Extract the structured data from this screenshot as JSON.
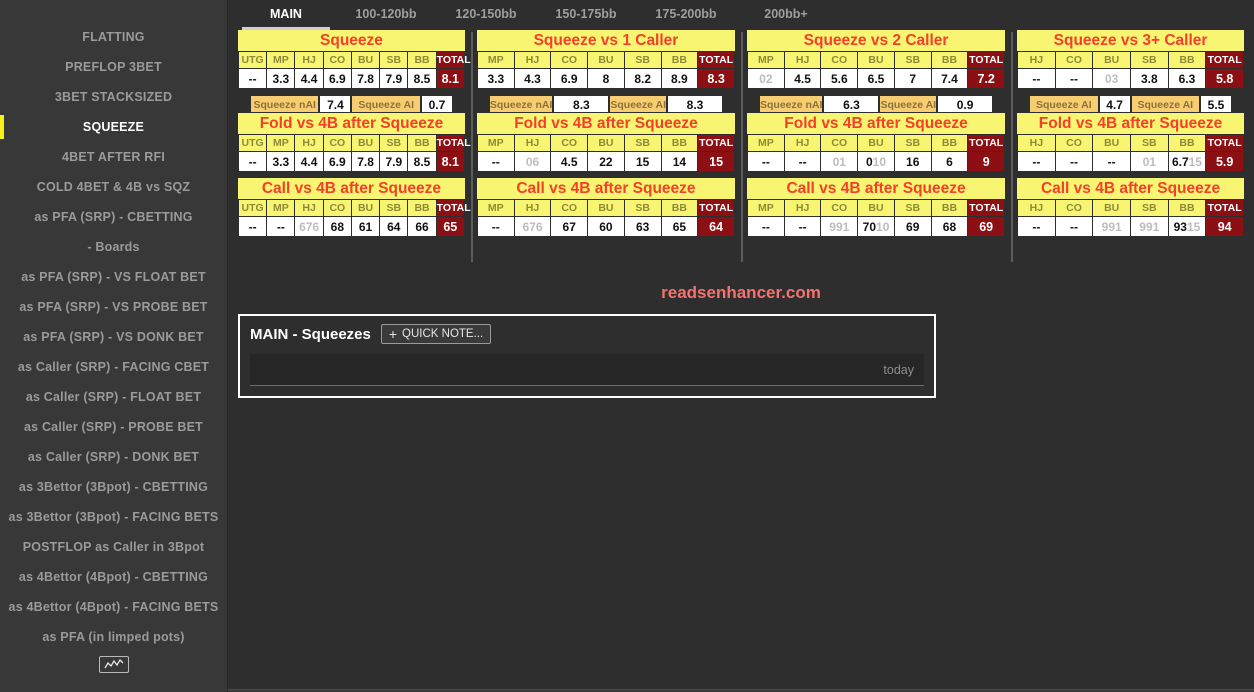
{
  "sidebar": {
    "items": [
      {
        "label": "FLATTING",
        "active": false
      },
      {
        "label": "PREFLOP 3BET",
        "active": false
      },
      {
        "label": "3BET STACKSIZED",
        "active": false
      },
      {
        "label": "SQUEEZE",
        "active": true
      },
      {
        "label": "4BET AFTER RFI",
        "active": false
      },
      {
        "label": "COLD 4BET & 4B vs SQZ",
        "active": false
      },
      {
        "label": "as PFA (SRP) - CBETTING",
        "active": false
      },
      {
        "label": "- Boards",
        "active": false
      },
      {
        "label": "as PFA (SRP) - VS FLOAT BET",
        "active": false
      },
      {
        "label": "as PFA (SRP) - VS PROBE BET",
        "active": false
      },
      {
        "label": "as PFA (SRP) - VS DONK BET",
        "active": false
      },
      {
        "label": "as Caller (SRP) - FACING CBET",
        "active": false
      },
      {
        "label": "as Caller (SRP) - FLOAT BET",
        "active": false
      },
      {
        "label": "as Caller (SRP) - PROBE BET",
        "active": false
      },
      {
        "label": "as Caller (SRP) - DONK BET",
        "active": false
      },
      {
        "label": "as 3Bettor (3Bpot) - CBETTING",
        "active": false
      },
      {
        "label": "as 3Bettor (3Bpot) - FACING BETS",
        "active": false
      },
      {
        "label": "POSTFLOP as Caller in 3Bpot",
        "active": false
      },
      {
        "label": "as 4Bettor (4Bpot) - CBETTING",
        "active": false
      },
      {
        "label": "as 4Bettor (4Bpot) - FACING BETS",
        "active": false
      },
      {
        "label": "as PFA (in limped pots)",
        "active": false
      }
    ],
    "chart_button_icon": "line-chart-icon",
    "active_accent_color": "#f5f015"
  },
  "tabs": [
    {
      "label": "MAIN",
      "active": true
    },
    {
      "label": "100-120bb",
      "active": false
    },
    {
      "label": "120-150bb",
      "active": false
    },
    {
      "label": "150-175bb",
      "active": false
    },
    {
      "label": "175-200bb",
      "active": false
    },
    {
      "label": "200bb+",
      "active": false
    }
  ],
  "columns": [
    {
      "blocks": [
        {
          "title": "Squeeze",
          "headers": [
            "UTG",
            "MP",
            "HJ",
            "CO",
            "BU",
            "SB",
            "BB"
          ],
          "total_header": "TOTAL",
          "values": [
            "--",
            "3.3",
            "4.4",
            "6.9",
            "7.8",
            "7.9",
            "8.5"
          ],
          "dims": [
            "",
            "",
            "",
            "",
            "",
            "",
            ""
          ],
          "empty": [
            true,
            false,
            false,
            false,
            false,
            false,
            false
          ],
          "total": "8.1"
        },
        {
          "title": "Fold vs 4B after Squeeze",
          "headers": [
            "UTG",
            "MP",
            "HJ",
            "CO",
            "BU",
            "SB",
            "BB"
          ],
          "total_header": "TOTAL",
          "values": [
            "--",
            "3.3",
            "4.4",
            "6.9",
            "7.8",
            "7.9",
            "8.5"
          ],
          "dims": [
            "",
            "",
            "",
            "",
            "",
            "",
            ""
          ],
          "empty": [
            true,
            false,
            false,
            false,
            false,
            false,
            false
          ],
          "total": "8.1"
        },
        {
          "title": "Call vs 4B after Squeeze",
          "headers": [
            "UTG",
            "MP",
            "HJ",
            "CO",
            "BU",
            "SB",
            "BB"
          ],
          "total_header": "TOTAL",
          "values": [
            "--",
            "--",
            "676",
            "68",
            "61",
            "64",
            "66"
          ],
          "dims": [
            "",
            "",
            "all",
            "",
            "",
            "",
            ""
          ],
          "empty": [
            true,
            true,
            false,
            false,
            false,
            false,
            false
          ],
          "total": "65"
        }
      ],
      "ai_row": {
        "label1": "Squeeze nAI",
        "value1": "7.4",
        "label2": "Squeeze AI",
        "value2": "0.7",
        "wide": false
      }
    },
    {
      "blocks": [
        {
          "title": "Squeeze vs 1 Caller",
          "headers": [
            "MP",
            "HJ",
            "CO",
            "BU",
            "SB",
            "BB"
          ],
          "total_header": "TOTAL",
          "values": [
            "3.3",
            "4.3",
            "6.9",
            "8",
            "8.2",
            "8.9"
          ],
          "dims": [
            "",
            "",
            "",
            "",
            "",
            ""
          ],
          "empty": [
            false,
            false,
            false,
            false,
            false,
            false
          ],
          "total": "8.3"
        },
        {
          "title": "Fold vs 4B after Squeeze",
          "headers": [
            "MP",
            "HJ",
            "CO",
            "BU",
            "SB",
            "BB"
          ],
          "total_header": "TOTAL",
          "values": [
            "--",
            "06",
            "4.5",
            "22",
            "15",
            "14"
          ],
          "dims": [
            "",
            "all",
            "",
            "",
            "",
            ""
          ],
          "empty": [
            true,
            false,
            false,
            false,
            false,
            false
          ],
          "total": "15"
        },
        {
          "title": "Call vs 4B after Squeeze",
          "headers": [
            "MP",
            "HJ",
            "CO",
            "BU",
            "SB",
            "BB"
          ],
          "total_header": "TOTAL",
          "values": [
            "--",
            "676",
            "67",
            "60",
            "63",
            "65"
          ],
          "dims": [
            "",
            "all",
            "",
            "",
            "",
            ""
          ],
          "empty": [
            true,
            false,
            false,
            false,
            false,
            false
          ],
          "total": "64"
        }
      ],
      "ai_row": {
        "label1": "Squeeze nAI",
        "value1": "8.3",
        "label2": "Squeeze AI",
        "value2": "8.3",
        "wide": true
      }
    },
    {
      "blocks": [
        {
          "title": "Squeeze vs 2 Caller",
          "headers": [
            "MP",
            "HJ",
            "CO",
            "BU",
            "SB",
            "BB"
          ],
          "total_header": "TOTAL",
          "values": [
            "02",
            "4.5",
            "5.6",
            "6.5",
            "7",
            "7.4"
          ],
          "dims": [
            "all",
            "",
            "",
            "",
            "",
            ""
          ],
          "empty": [
            false,
            false,
            false,
            false,
            false,
            false
          ],
          "total": "7.2"
        },
        {
          "title": "Fold vs 4B after Squeeze",
          "headers": [
            "MP",
            "HJ",
            "CO",
            "BU",
            "SB",
            "BB"
          ],
          "total_header": "TOTAL",
          "values": [
            "--",
            "--",
            "01",
            "0|10",
            "16",
            "6"
          ],
          "dims": [
            "",
            "",
            "all",
            "tail",
            "",
            ""
          ],
          "empty": [
            true,
            true,
            false,
            false,
            false,
            false
          ],
          "total": "9"
        },
        {
          "title": "Call vs 4B after Squeeze",
          "headers": [
            "MP",
            "HJ",
            "CO",
            "BU",
            "SB",
            "BB"
          ],
          "total_header": "TOTAL",
          "values": [
            "--",
            "--",
            "991",
            "70|10",
            "69",
            "68"
          ],
          "dims": [
            "",
            "",
            "all",
            "tail",
            "",
            ""
          ],
          "empty": [
            true,
            true,
            false,
            false,
            false,
            false
          ],
          "total": "69"
        }
      ],
      "ai_row": {
        "label1": "Squeeze nAI",
        "value1": "6.3",
        "label2": "Squeeze AI",
        "value2": "0.9",
        "wide": true
      }
    },
    {
      "blocks": [
        {
          "title": "Squeeze vs 3+ Caller",
          "headers": [
            "HJ",
            "CO",
            "BU",
            "SB",
            "BB"
          ],
          "total_header": "TOTAL",
          "values": [
            "--",
            "--",
            "03",
            "3.8",
            "6.3"
          ],
          "dims": [
            "",
            "",
            "all",
            "",
            ""
          ],
          "empty": [
            true,
            true,
            false,
            false,
            false
          ],
          "total": "5.8"
        },
        {
          "title": "Fold vs 4B after Squeeze",
          "headers": [
            "HJ",
            "CO",
            "BU",
            "SB",
            "BB"
          ],
          "total_header": "TOTAL",
          "values": [
            "--",
            "--",
            "--",
            "01",
            "6.7|15"
          ],
          "dims": [
            "",
            "",
            "",
            "all",
            "tail"
          ],
          "empty": [
            true,
            true,
            true,
            false,
            false
          ],
          "total": "5.9"
        },
        {
          "title": "Call vs 4B after Squeeze",
          "headers": [
            "HJ",
            "CO",
            "BU",
            "SB",
            "BB"
          ],
          "total_header": "TOTAL",
          "values": [
            "--",
            "--",
            "991",
            "991",
            "93|15"
          ],
          "dims": [
            "",
            "",
            "all",
            "all",
            "tail"
          ],
          "empty": [
            true,
            true,
            false,
            false,
            false
          ],
          "total": "94"
        }
      ],
      "ai_row": {
        "label1": "Squeeze AI",
        "value1": "4.7",
        "label2": "Squeeze AI",
        "value2": "5.5",
        "wide": false
      }
    }
  ],
  "watermark": "readsenhancer.com",
  "note": {
    "title": "MAIN - Squeezes",
    "quick_note_label": "QUICK NOTE...",
    "date": "today",
    "text": ""
  },
  "colors": {
    "panel_header_bg": "#f7f571",
    "panel_header_text": "#f4402a",
    "total_bg": "#8c0f14",
    "ai_label_bg": "#f8cd72",
    "accent": "#f5f015",
    "watermark": "#f4726f"
  }
}
